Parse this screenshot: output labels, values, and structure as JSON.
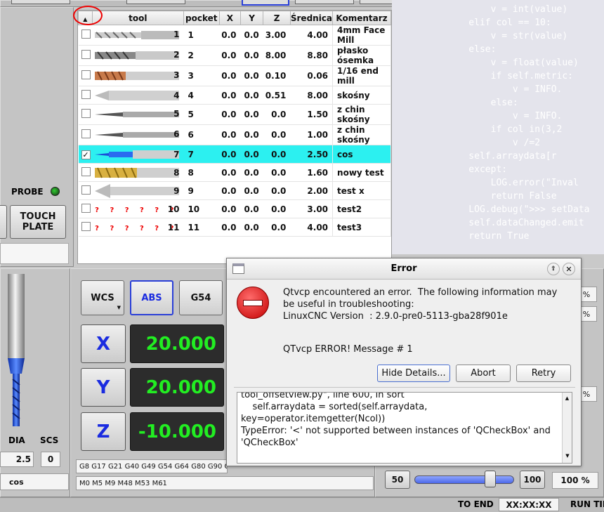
{
  "tool_table": {
    "headers": [
      "",
      "tool",
      "pocket",
      "X",
      "Y",
      "Z",
      "Średnica",
      "Komentarz"
    ],
    "rows": [
      {
        "tool": "1",
        "pocket": "1",
        "x": "0.0",
        "y": "0.0",
        "z": "3.00",
        "dia": "4.00",
        "comment": "4mm Face Mill",
        "checked": false,
        "icon": "face-mill-icon"
      },
      {
        "tool": "2",
        "pocket": "2",
        "x": "0.0",
        "y": "0.0",
        "z": "8.00",
        "dia": "8.80",
        "comment": "płasko ósemka",
        "checked": false,
        "icon": "flat-endmill-icon"
      },
      {
        "tool": "3",
        "pocket": "3",
        "x": "0.0",
        "y": "0.0",
        "z": "0.10",
        "dia": "0.06",
        "comment": "1/16 end mill",
        "checked": false,
        "icon": "coated-endmill-icon"
      },
      {
        "tool": "4",
        "pocket": "4",
        "x": "0.0",
        "y": "0.0",
        "z": "0.51",
        "dia": "8.00",
        "comment": "skośny",
        "checked": false,
        "icon": "chamfer-icon"
      },
      {
        "tool": "5",
        "pocket": "5",
        "x": "0.0",
        "y": "0.0",
        "z": "0.0",
        "dia": "1.50",
        "comment": "z chin skośny",
        "checked": false,
        "icon": "engraver-icon"
      },
      {
        "tool": "6",
        "pocket": "6",
        "x": "0.0",
        "y": "0.0",
        "z": "0.0",
        "dia": "1.00",
        "comment": "z chin skośny",
        "checked": false,
        "icon": "engraver-icon"
      },
      {
        "tool": "7",
        "pocket": "7",
        "x": "0.0",
        "y": "0.0",
        "z": "0.0",
        "dia": "2.50",
        "comment": "cos",
        "checked": true,
        "icon": "blue-endmill-icon"
      },
      {
        "tool": "8",
        "pocket": "8",
        "x": "0.0",
        "y": "0.0",
        "z": "0.0",
        "dia": "1.60",
        "comment": "nowy test",
        "checked": false,
        "icon": "gold-endmill-icon"
      },
      {
        "tool": "9",
        "pocket": "9",
        "x": "0.0",
        "y": "0.0",
        "z": "0.0",
        "dia": "2.00",
        "comment": "test x",
        "checked": false,
        "icon": "countersink-icon"
      },
      {
        "tool": "10",
        "pocket": "10",
        "x": "0.0",
        "y": "0.0",
        "z": "0.0",
        "dia": "3.00",
        "comment": "test2",
        "checked": false,
        "icon": "unknown-tool-icon"
      },
      {
        "tool": "11",
        "pocket": "11",
        "x": "0.0",
        "y": "0.0",
        "z": "0.0",
        "dia": "4.00",
        "comment": "test3",
        "checked": false,
        "icon": "unknown-tool-icon"
      }
    ]
  },
  "unknown_marks": "? ? ? ? ? ?",
  "code_bg": "        v = int(value)\n    elif col == 10:\n        v = str(value)\n    else:\n        v = float(value)\n        if self.metric:\n            v = INFO.\n        else:\n            v = INFO.\n        if col in(3,2\n            v /=2\n    self.arraydata[r\n    except:\n        LOG.error(\"Inval\n        return False\n    LOG.debug(\">>> setData\n    self.dataChanged.emit\n    return True",
  "left": {
    "probe": "PROBE",
    "touch_plate": "TOUCH\nPLATE",
    "dia_label": "DIA",
    "scs_label": "SCS",
    "dia_value": "2.5",
    "scs_value": "0",
    "tool_comment": "cos"
  },
  "dro": {
    "wcs": "WCS",
    "abs": "ABS",
    "g54": "G54",
    "x_label": "X",
    "y_label": "Y",
    "z_label": "Z",
    "x_value": "20.000",
    "y_value": "20.000",
    "z_value": "-10.000"
  },
  "gcodes": "G8 G17 G21 G40 G49 G54 G64 G80 G90 G",
  "mcodes": "M0 M5 M9 M48 M53 M61",
  "rate": {
    "min": "50",
    "max": "100",
    "pct": "100 %",
    "value": 100
  },
  "status": {
    "to_end": "TO END",
    "time": "XX:XX:XX",
    "run_time": "RUN TIM"
  },
  "dialog": {
    "title": "Error",
    "message": "Qtvcp encountered an error.  The following information may\nbe useful in troubleshooting:\nLinuxCNC Version  : 2.9.0-pre0-5113-gba28f901e",
    "sub": "QTvcp ERROR! Message # 1",
    "hide_details": "Hide Details...",
    "abort": "Abort",
    "retry": "Retry",
    "details": "tool_offsetview.py\", line 600, in sort\n    self.arraydata = sorted(self.arraydata,\nkey=operator.itemgetter(Ncol))\nTypeError: '<' not supported between instances of 'QCheckBox' and\n'QCheckBox'"
  },
  "right_edge": {
    "pct1": "%",
    "pct2": "%",
    "pct3": "%"
  }
}
